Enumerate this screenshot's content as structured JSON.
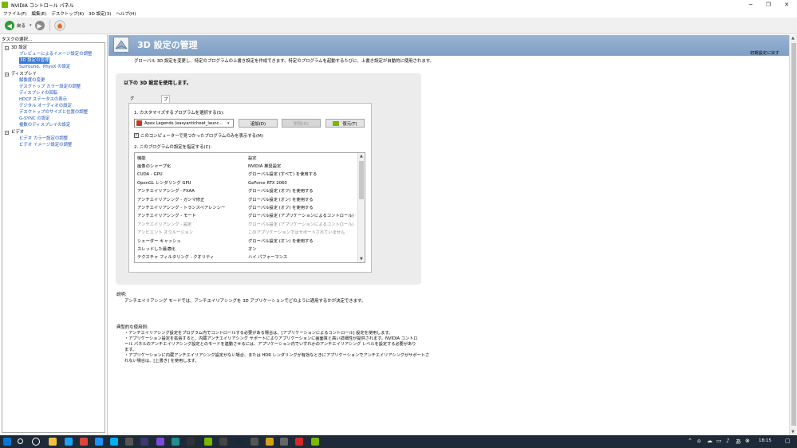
{
  "window": {
    "title": "NVIDIA コントロール パネル",
    "minimize_glyph": "─",
    "maximize_glyph": "❐",
    "close_glyph": "✕"
  },
  "menu": [
    "ファイル(F)",
    "編集(E)",
    "デスクトップ(K)",
    "3D 設定(3)",
    "ヘルプ(H)"
  ],
  "toolbar": {
    "back_label": "戻る",
    "back_icon": "left-arrow-icon",
    "forward_icon": "right-arrow-icon",
    "home_icon": "home-icon"
  },
  "sidebar": {
    "task_label": "タスクの選択...",
    "items": [
      {
        "label": "3D 設定",
        "type": "category",
        "expander": "−"
      },
      {
        "label": "プレビューによるイメージ設定の調整",
        "type": "link"
      },
      {
        "label": "3D 設定の管理",
        "type": "selected"
      },
      {
        "label": "Surround、PhysX の設定",
        "type": "link"
      },
      {
        "label": "ディスプレイ",
        "type": "category",
        "expander": "−"
      },
      {
        "label": "解像度の変更",
        "type": "link"
      },
      {
        "label": "デスクトップ カラー設定の調整",
        "type": "link"
      },
      {
        "label": "ディスプレイの回転",
        "type": "link"
      },
      {
        "label": "HDCP ステータスの表示",
        "type": "link"
      },
      {
        "label": "デジタル オーディオの設定",
        "type": "link"
      },
      {
        "label": "デスクトップのサイズと位置の調整",
        "type": "link"
      },
      {
        "label": "G-SYNC の設定",
        "type": "link"
      },
      {
        "label": "複数のディスプレイの設定",
        "type": "link"
      },
      {
        "label": "ビデオ",
        "type": "category",
        "expander": "−"
      },
      {
        "label": "ビデオ カラー設定の調整",
        "type": "link"
      },
      {
        "label": "ビデオ イメージ設定の調整",
        "type": "link"
      }
    ]
  },
  "header": {
    "title": "3D 設定の管理",
    "reset_label": "初期設定に戻す",
    "description": "グローバル 3D 設定を変更し、特定のプログラムの上書き設定を作成できます。特定のプログラムを起動するたびに、上書き設定が自動的に使用されます。"
  },
  "panel": {
    "heading": "以下の 3D 設定を使用します。",
    "tabs": [
      "グローバル設定",
      "プログラム設定"
    ],
    "active_tab": "プログラム設定",
    "step1_label": "1. カスタマイズするプログラムを選択する(S):",
    "program_value": "Apex Legends (easyanticheat_launc...",
    "add_button": "追加(D)",
    "remove_button": "削除(R)",
    "restore_button": "復元(T)",
    "checkbox_label": "このコンピューターで見つかったプログラムのみを表示する(M)",
    "checkbox_glyph": "✓",
    "checkbox_checked": true,
    "step2_label": "2. このプログラムの設定を指定する(C):"
  },
  "settings_table": {
    "columns": [
      "機能",
      "設定"
    ],
    "rows": [
      {
        "feature": "画像のシャープ化",
        "setting": "NVIDIA 推奨設定",
        "dim": false
      },
      {
        "feature": "CUDA - GPU",
        "setting": "グローバル設定 (すべて) を使用する",
        "dim": false
      },
      {
        "feature": "OpenGL レンダリング GPU",
        "setting": "GeForce RTX 2060",
        "dim": false
      },
      {
        "feature": "アンチエイリアシング - FXAA",
        "setting": "グローバル設定 (オフ) を使用する",
        "dim": false
      },
      {
        "feature": "アンチエイリアシング - ガンマ修正",
        "setting": "グローバル設定 (オン) を使用する",
        "dim": false
      },
      {
        "feature": "アンチエイリアシング - トランスペアレンシー",
        "setting": "グローバル設定 (オフ) を使用する",
        "dim": false
      },
      {
        "feature": "アンチエイリアシング - モード",
        "setting": "グローバル設定 (アプリケーションによるコントロール) を...",
        "dim": false
      },
      {
        "feature": "アンチエイリアシング - 設定",
        "setting": "グローバル設定 (アプリケーションによるコントロール) を...",
        "dim": true
      },
      {
        "feature": "アンビエント オクルージョン",
        "setting": "このアプリケーションではサポートされていません",
        "dim": true
      },
      {
        "feature": "シェーダー キャッシュ",
        "setting": "グローバル設定 (オン) を使用する",
        "dim": false
      },
      {
        "feature": "スレッドした最適化",
        "setting": "オン",
        "dim": false
      },
      {
        "feature": "テクスチャ フィルタリング - クオリティ",
        "setting": "ハイ パフォーマンス",
        "dim": false
      }
    ]
  },
  "explanation": {
    "label": "説明:",
    "text": "アンチエイリアシング モードでは、アンチエイリアシングを 3D アプリケーションでどのように適用するかが決定できます。"
  },
  "usage": {
    "label": "典型的な使用例:",
    "lines": [
      "・アンチエイリアシング設定をプログラム内でコントロールする必要がある場合は、[アプリケーションによるコントロール] 設定を使用します。",
      "・アプリケーション設定を拡張すると、内蔵アンチエイリアシング サポートによりアプリケーションに画面質と高い詳細性が提供されます。NVIDIA コントロ",
      "ール パネルのアンチエイリアシング設定とのモードを連動させるには、アプリケーション内でいずれかのアンチエイリアシング レベルを設定する必要があり",
      "ます。",
      "・アプリケーションに内蔵アンチエイリアシング設定がない場合、または HDR レンダリングが有効なときにアプリケーションでアンチエイリアシングがサポートさ",
      "れない場合は、[上書き] を使用します。"
    ]
  },
  "taskbar": {
    "clock": "18:15",
    "icons": [
      "windows-start-icon",
      "search-icon",
      "cortana-icon",
      "file-explorer-icon",
      "twitter-icon",
      "chrome-icon",
      "edge-icon",
      "skype-icon",
      "app-icon",
      "app-icon",
      "app-icon",
      "app-icon",
      "app-icon",
      "nvidia-icon",
      "app-icon",
      "steam-icon",
      "app-icon",
      "app-icon",
      "settings-icon",
      "app-icon",
      "nvidia-control-panel-icon"
    ],
    "colors": [
      "#0078d7",
      "#ffffff",
      "#ffffff",
      "#f0c040",
      "#1da1f2",
      "#db4437",
      "#1e90ff",
      "#00aff0",
      "#555555",
      "#3a3a6a",
      "#7d4bd8",
      "#1e8f8f",
      "#333333",
      "#76b900",
      "#444444",
      "#1b2838",
      "#555555",
      "#d4a017",
      "#666666",
      "#d62828",
      "#76b900"
    ]
  },
  "colors": {
    "banner": "#8ea9ca",
    "selection": "#3478d4",
    "link": "#1a4fb5",
    "nvidia_green": "#76b900",
    "taskbar": "#1f2a38"
  }
}
